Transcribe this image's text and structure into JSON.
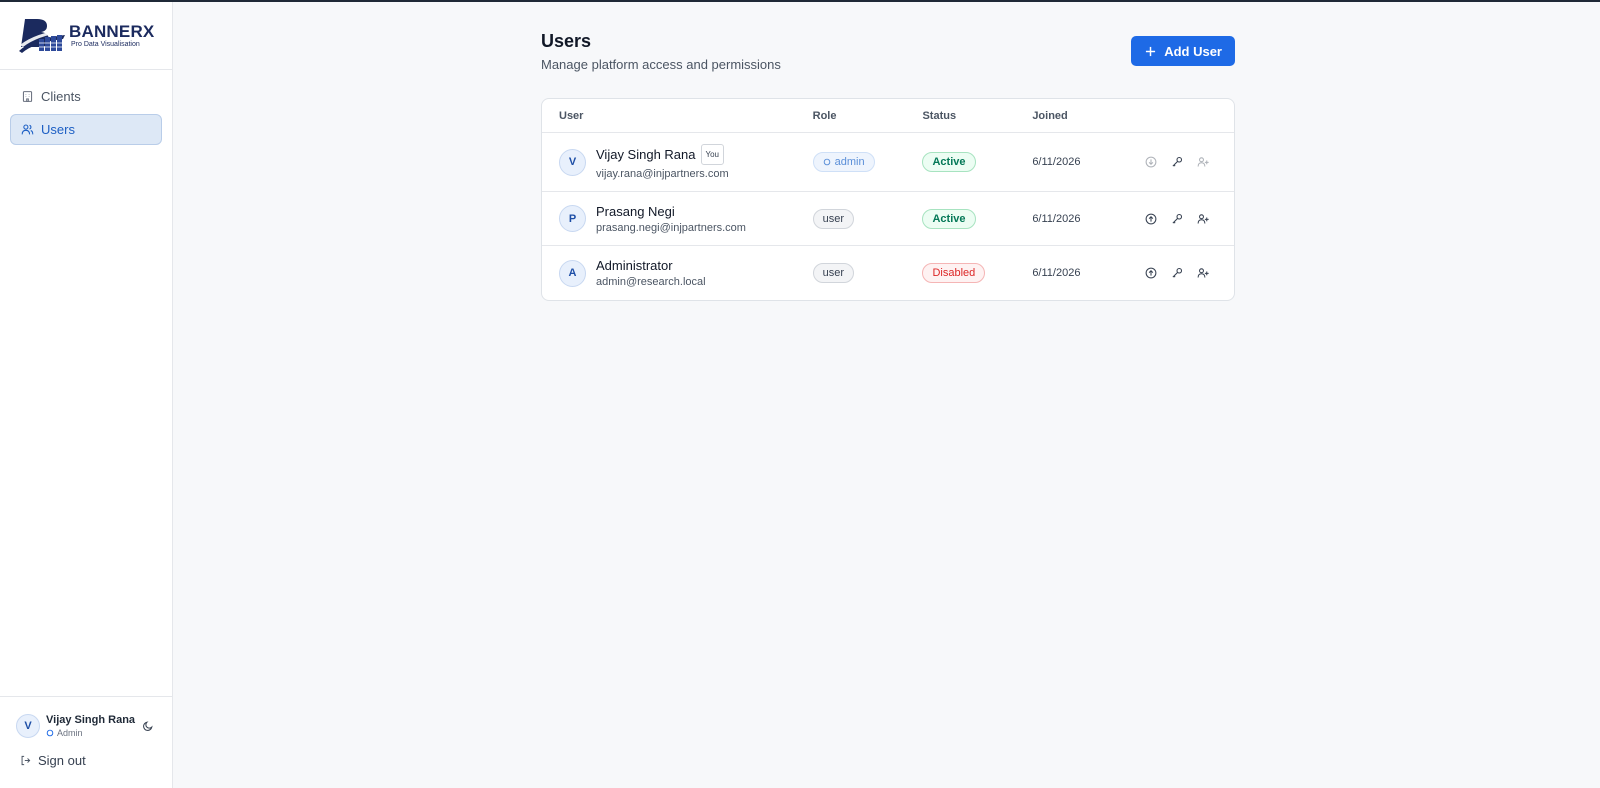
{
  "brand": {
    "name": "BANNERX",
    "tagline": "Pro Data Visualisation",
    "color": "#1b2a5e"
  },
  "sidebar": {
    "items": [
      {
        "label": "Clients",
        "icon": "building-icon",
        "active": false
      },
      {
        "label": "Users",
        "icon": "users-icon",
        "active": true
      }
    ],
    "current_user": {
      "initial": "V",
      "name": "Vijay Singh Rana",
      "role": "Admin"
    },
    "sign_out_label": "Sign out"
  },
  "page": {
    "title": "Users",
    "subtitle": "Manage platform access and permissions",
    "add_button_label": "Add User"
  },
  "table": {
    "headers": {
      "user": "User",
      "role": "Role",
      "status": "Status",
      "joined": "Joined"
    },
    "rows": [
      {
        "initial": "V",
        "name": "Vijay Singh Rana",
        "you_badge": "You",
        "email": "vijay.rana@injpartners.com",
        "role": "admin",
        "status": "Active",
        "joined": "6/11/2026"
      },
      {
        "initial": "P",
        "name": "Prasang Negi",
        "email": "prasang.negi@injpartners.com",
        "role": "user",
        "status": "Active",
        "joined": "6/11/2026"
      },
      {
        "initial": "A",
        "name": "Administrator",
        "email": "admin@research.local",
        "role": "user",
        "status": "Disabled",
        "joined": "6/11/2026"
      }
    ]
  },
  "colors": {
    "accent": "#1e6ae6",
    "active": "#047857",
    "disabled": "#dc2626"
  }
}
